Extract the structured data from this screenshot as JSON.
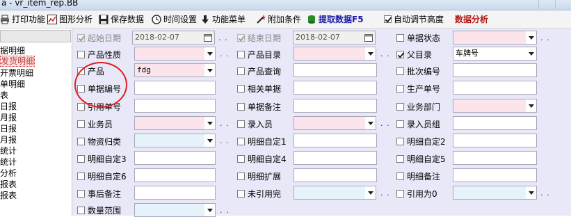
{
  "window": {
    "title": "a - vr_item_rep.BB"
  },
  "toolbar": {
    "print": "打印功能",
    "chart": "图形分析",
    "save": "保存数据",
    "time": "时间设置",
    "menu": "功能菜单",
    "condition": "附加条件",
    "fetch": "提取数据F5",
    "autoheight": "自动调节高度",
    "autoheight_checked": true,
    "analysis": "数据分析"
  },
  "tree": {
    "items": [
      "据明细",
      "发货明细",
      "开票明细",
      "单明细",
      "表",
      "日报",
      "月报",
      "日报",
      "月报",
      "统计",
      "统计",
      "分析",
      "报表",
      "报表"
    ],
    "selected_index": 1
  },
  "filters": {
    "start_date_label": "起始日期",
    "start_date_value": "2018-02-07",
    "end_date_label": "结束日期",
    "end_date_value": "2018-02-07",
    "doc_status_label": "单据状态",
    "product_nature_label": "产品性质",
    "product_catalog_label": "产品目录",
    "parent_catalog_label": "父目录",
    "parent_catalog_value": "车牌号",
    "product_label": "产品",
    "product_value": "fdg",
    "product_query_label": "产品查询",
    "batch_no_label": "批次编号",
    "doc_no_label": "单据编号",
    "related_doc_label": "相关单据",
    "production_no_label": "生产单号",
    "ref_doc_no_label": "引用单号",
    "doc_remark_label": "单据备注",
    "dept_label": "业务部门",
    "salesman_label": "业务员",
    "entry_user_label": "录入员",
    "entry_group_label": "录入员组",
    "material_class_label": "物资归类",
    "custom1_label": "明细自定1",
    "custom2_label": "明细自定2",
    "custom3_label": "明细自定3",
    "custom4_label": "明细自定4",
    "custom5_label": "明细自定5",
    "custom6_label": "明细自定6",
    "detail_ext_label": "明细扩展",
    "detail_remark_label": "明细备注",
    "post_remark_label": "事后备注",
    "unreferenced_label": "未引用完",
    "ref_zero_label": "引用为0",
    "qty_range_label": "数量范围",
    "dots": ". ."
  }
}
